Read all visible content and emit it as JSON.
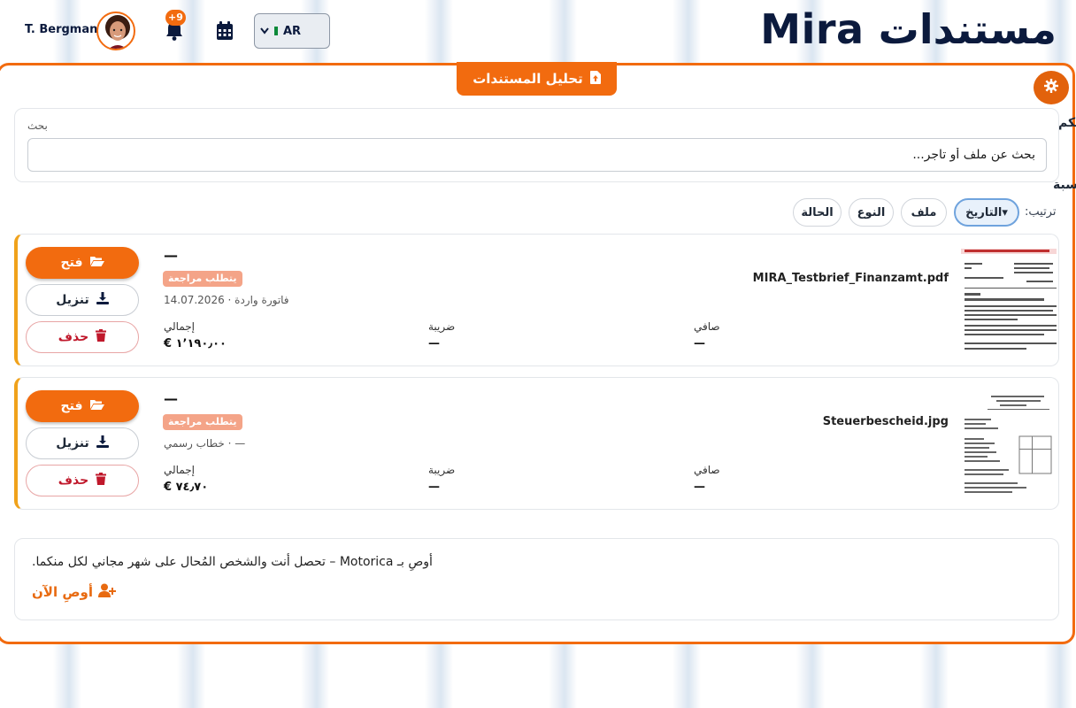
{
  "header": {
    "brand": "مستندات Mira",
    "user_name": "T. Bergmann",
    "notifications_count": "+9",
    "language_code": "AR"
  },
  "toolbar": {
    "upload_label": "تحليل المستندات",
    "clipped_label_1": "حكم",
    "clipped_label_2": "سبة"
  },
  "search": {
    "label": "بحث",
    "placeholder": "بحث عن ملف أو تاجر..."
  },
  "sort": {
    "label": "ترتيب:",
    "options": [
      "التاريخ▾",
      "ملف",
      "النوع",
      "الحالة"
    ]
  },
  "documents": [
    {
      "file_name": "MIRA_Testbrief_Finanzamt.pdf",
      "title": "—",
      "status": "يتطلب مراجعة",
      "meta": "فاتورة واردة · 14.07.2026",
      "total_label": "إجمالي",
      "total": "€ ١٬١٩٠٫٠٠",
      "tax_label": "ضريبة",
      "tax": "—",
      "net_label": "صافي",
      "net": "—"
    },
    {
      "file_name": "Steuerbescheid.jpg",
      "title": "—",
      "status": "يتطلب مراجعة",
      "meta": "خطاب رسمي · —",
      "total_label": "إجمالي",
      "total": "€ ٧٤٫٧٠",
      "tax_label": "ضريبة",
      "tax": "—",
      "net_label": "صافي",
      "net": "—"
    }
  ],
  "actions": {
    "open": "فتح",
    "download": "تنزيل",
    "delete": "حذف"
  },
  "referral": {
    "text": "أوصِ بـ Motorica – تحصل أنت والشخص المُحال على شهر مجاني لكل منكما.",
    "link": "أوصِ الآن"
  },
  "colors": {
    "accent": "#f26b0f",
    "status_badge": "#f4a488",
    "card_stripe": "#f0a21b",
    "danger": "#c0182b",
    "brand_text": "#0b1a3d"
  }
}
